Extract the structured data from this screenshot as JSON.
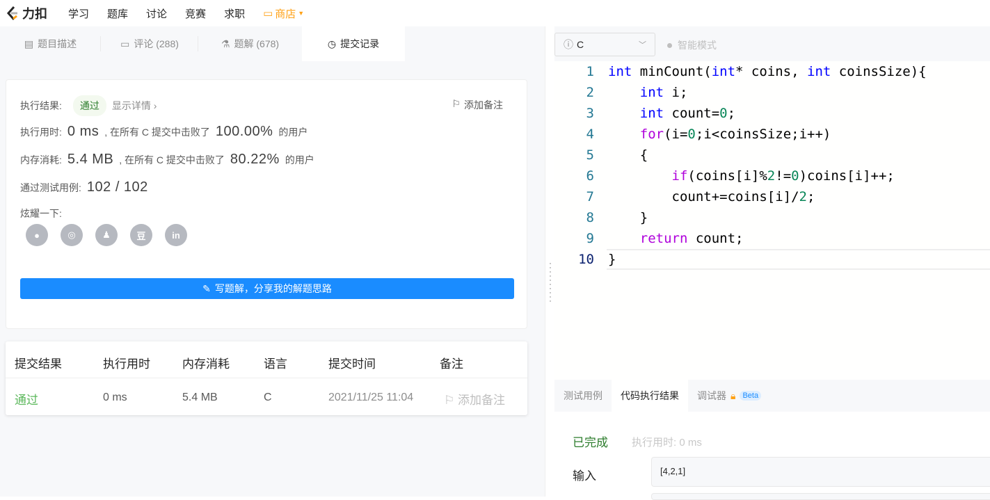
{
  "nav": {
    "logo": "力扣",
    "items": [
      "学习",
      "题库",
      "讨论",
      "竞赛",
      "求职"
    ],
    "shop": "商店"
  },
  "tabs": [
    {
      "label": "题目描述",
      "icon": "description-icon"
    },
    {
      "label": "评论 (288)",
      "icon": "comment-icon"
    },
    {
      "label": "题解 (678)",
      "icon": "flask-icon"
    },
    {
      "label": "提交记录",
      "icon": "clock-icon"
    }
  ],
  "result": {
    "result_label": "执行结果:",
    "status": "通过",
    "details": "显示详情 ›",
    "add_note": "添加备注",
    "time_label": "执行用时:",
    "time": "0 ms",
    "time_mid": ", 在所有 C 提交中击败了",
    "time_pct": "100.00%",
    "users": "的用户",
    "mem_label": "内存消耗:",
    "mem": "5.4 MB",
    "mem_mid": ", 在所有 C 提交中击败了",
    "mem_pct": "80.22%",
    "tests_label": "通过测试用例:",
    "tests": "102 / 102",
    "share_label": "炫耀一下:",
    "write_button": "写题解，分享我的解题思路"
  },
  "table": {
    "headers": [
      "提交结果",
      "执行用时",
      "内存消耗",
      "语言",
      "提交时间",
      "备注"
    ],
    "rows": [
      {
        "status": "通过",
        "time": "0 ms",
        "memory": "5.4 MB",
        "lang": "C",
        "submitted": "2021/11/25 11:04",
        "note": "添加备注"
      }
    ]
  },
  "editor": {
    "language": "C",
    "smart_mode": "智能模式",
    "lines": [
      "1",
      "2",
      "3",
      "4",
      "5",
      "6",
      "7",
      "8",
      "9",
      "10"
    ]
  },
  "bottom": {
    "tabs": [
      "测试用例",
      "代码执行结果",
      "调试器"
    ],
    "beta": "Beta",
    "done": "已完成",
    "exec_time": "执行用时: 0 ms",
    "input_label": "输入",
    "input_value": "[4,2,1]"
  },
  "colors": {
    "accent": "#1a8cff",
    "shop": "#ffa116",
    "success": "#5cb85c"
  }
}
